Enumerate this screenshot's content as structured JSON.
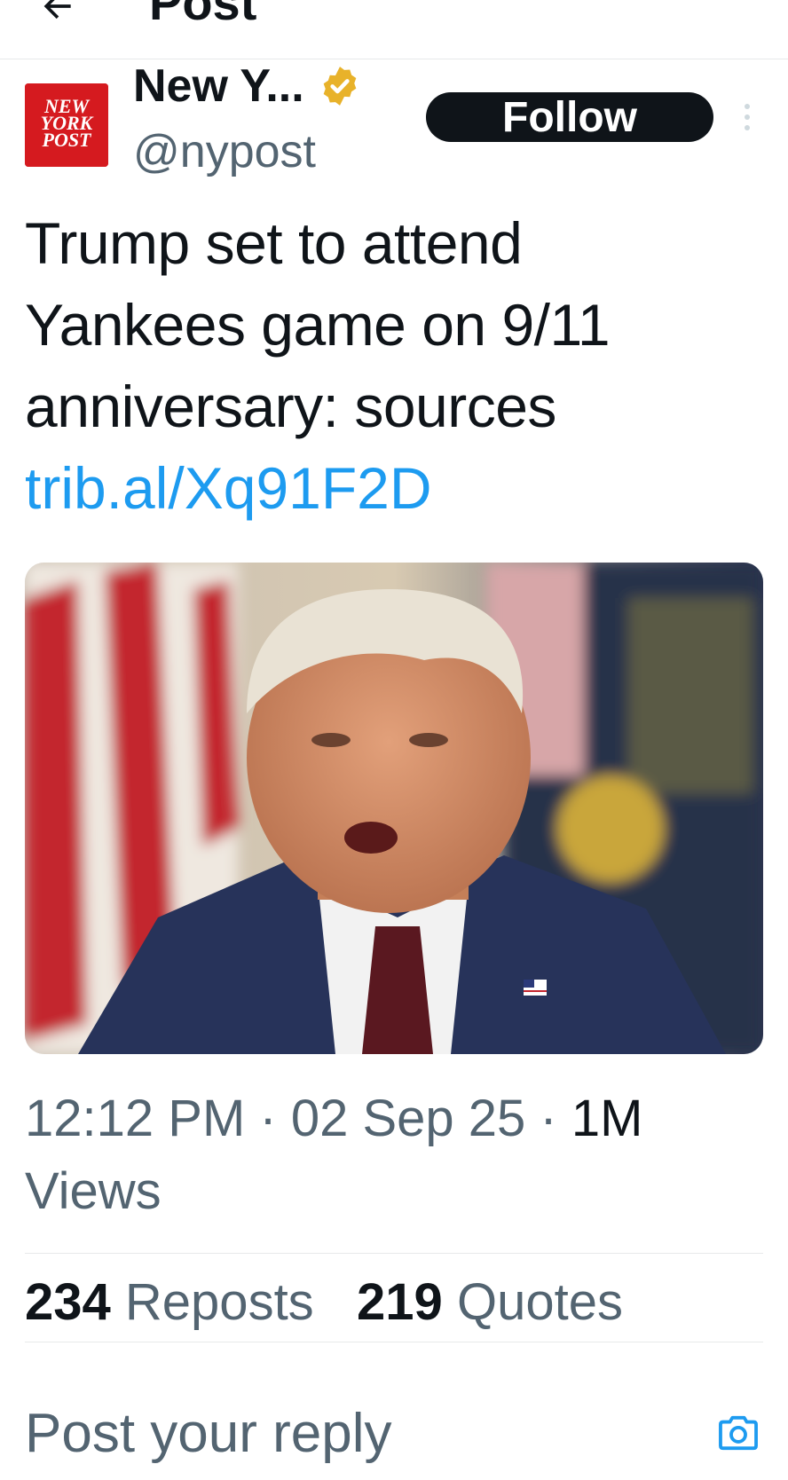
{
  "header": {
    "title": "Post",
    "back_icon": "arrow-left-icon"
  },
  "author": {
    "name": "New Y...",
    "handle": "@nypost",
    "avatar_lines": [
      "NEW",
      "YORK",
      "POST"
    ],
    "verified_icon": "verified-badge-icon",
    "follow_label": "Follow",
    "more_icon": "more-vertical-icon"
  },
  "post": {
    "text_lines": [
      "Trump set to attend",
      "Yankees game on 9/11",
      "anniversary: sources"
    ],
    "link": "trib.al/Xq91F2D"
  },
  "meta": {
    "time": "12:12 PM",
    "date": "02 Sep 25",
    "views_count": "1M",
    "views_label": "Views"
  },
  "stats": {
    "reposts_count": "234",
    "reposts_label": "Reposts",
    "quotes_count": "219",
    "quotes_label": "Quotes"
  },
  "reply": {
    "placeholder": "Post your reply",
    "camera_icon": "camera-icon"
  },
  "colors": {
    "text": "#0f1419",
    "secondary": "#536471",
    "link": "#1d9bf0",
    "verified": "#e8b22a",
    "brand_red": "#d51a1f"
  }
}
